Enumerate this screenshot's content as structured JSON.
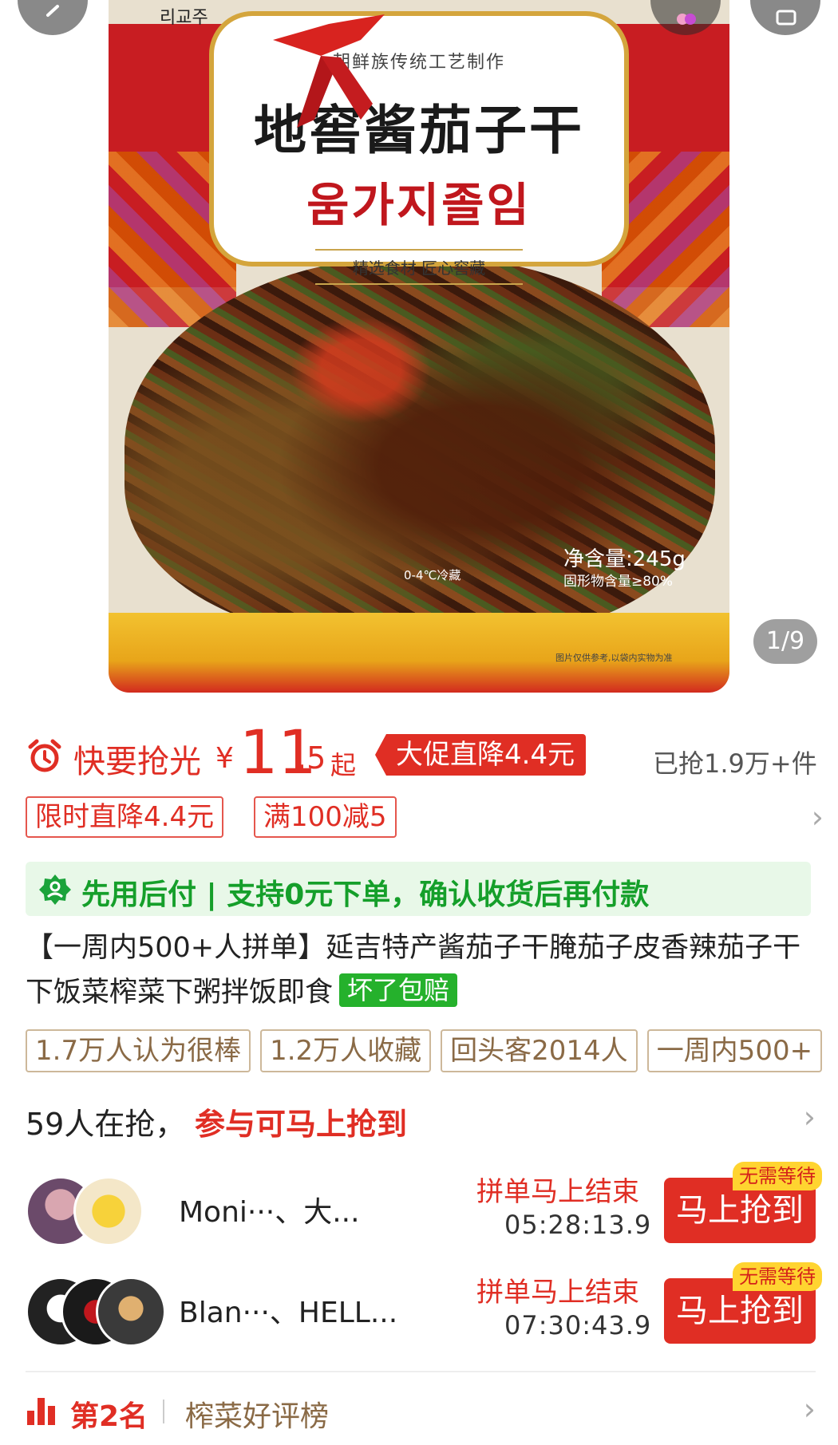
{
  "hero": {
    "brand_tag": "리교주",
    "package_subtitle": "朝鲜族传统工艺制作",
    "package_title_cn": "地窖酱茄子干",
    "package_title_kr": "움가지졸임",
    "package_slogan": "精选食材 匠心窖藏",
    "package_net": "净含量:245g",
    "package_solid": "固形物含量≥80%",
    "package_storage": "0-4℃冷藏",
    "package_note": "图片仅供参考,以袋内实物为准",
    "image_counter": "1/9",
    "icons": [
      "back-icon",
      "share-icon",
      "cart-icon"
    ]
  },
  "price": {
    "urgency": "快要抢光",
    "currency": "¥",
    "integer": "11",
    "decimal": ".5",
    "suffix": "起",
    "promo_badge": "大促直降4.4元",
    "sold": "已抢1.9万+件",
    "accent_color": "#e02e24"
  },
  "coupons": [
    "限时直降4.4元",
    "满100减5"
  ],
  "pay_later": {
    "text": "先用后付 | 支持0元下单，确认收货后再付款",
    "color": "#159f2a"
  },
  "product": {
    "title": "【一周内500+人拼单】延吉特产酱茄子干腌茄子皮香辣茄子干下饭菜榨菜下粥拌饭即食",
    "guarantee": "坏了包赔"
  },
  "tags": [
    "1.7万人认为很棒",
    "1.2万人收藏",
    "回头客2014人",
    "一周内500+"
  ],
  "group_buy": {
    "count": "59人在抢，",
    "cta": "参与可马上抢到",
    "groups": [
      {
        "names": "Moni···、大...",
        "ending": "拼单马上结束",
        "timer": "05:28:13.9",
        "button": "马上抢到",
        "badge": "无需等待"
      },
      {
        "names": "Blan···、HELL...",
        "ending": "拼单马上结束",
        "timer": "07:30:43.9",
        "button": "马上抢到",
        "badge": "无需等待"
      }
    ]
  },
  "rank": {
    "position": "第2名",
    "list": "榨菜好评榜"
  }
}
